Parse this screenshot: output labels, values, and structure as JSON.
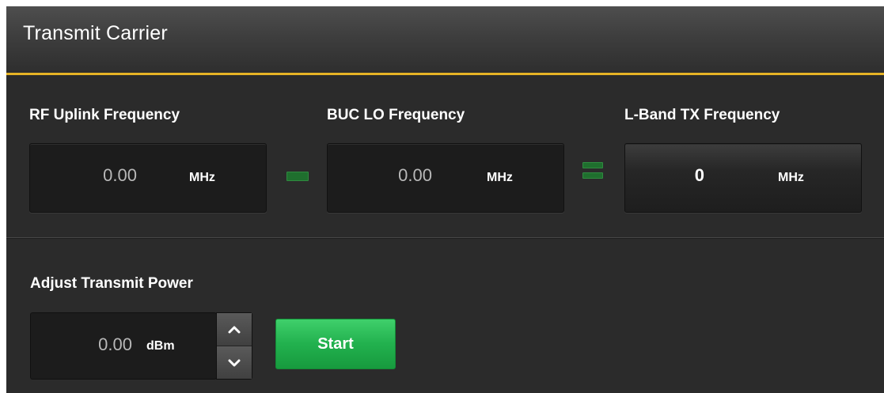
{
  "header": {
    "title": "Transmit Carrier"
  },
  "frequencies": {
    "rf_uplink": {
      "label": "RF Uplink Frequency",
      "value": "0.00",
      "unit": "MHz"
    },
    "buc_lo": {
      "label": "BUC LO Frequency",
      "value": "0.00",
      "unit": "MHz"
    },
    "lband_tx": {
      "label": "L-Band TX Frequency",
      "value": "0",
      "unit": "MHz"
    }
  },
  "operators": {
    "minus": "minus-icon",
    "equals": "equals-icon"
  },
  "power": {
    "label": "Adjust Transmit Power",
    "value": "0.00",
    "unit": "dBm",
    "up_icon": "chevron-up-icon",
    "down_icon": "chevron-down-icon"
  },
  "actions": {
    "start_label": "Start"
  },
  "colors": {
    "accent_line": "#e6b325",
    "start_button": "#22b14e",
    "operator_green": "#1f6f2e"
  }
}
